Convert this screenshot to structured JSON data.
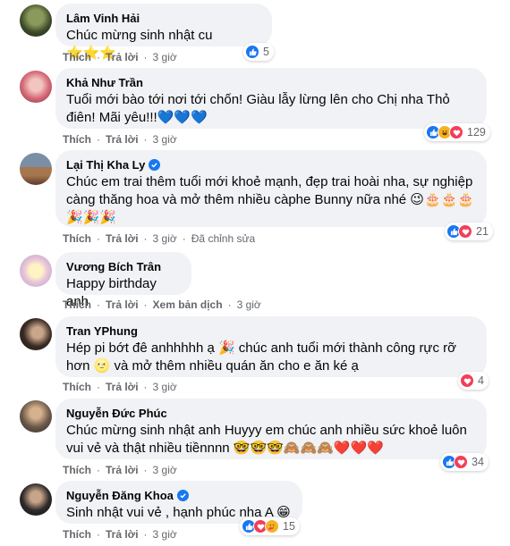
{
  "colors": {
    "like": "#1877f2",
    "love": "#f33e58",
    "haha": "#f7b125",
    "bubble": "#f0f2f5",
    "meta": "#65676b"
  },
  "actions": {
    "like": "Thích",
    "reply": "Trả lời",
    "translate": "Xem bản dịch",
    "edited": "Đã chỉnh sửa",
    "sep": "·"
  },
  "comments": [
    {
      "name": "Lâm Vinh Hải",
      "text": "Chúc mừng sinh nhật cu ⭐⭐⭐",
      "time": "3 giờ",
      "reactions": "5"
    },
    {
      "name": "Khả Như Trần",
      "text": "Tuổi mới bào tới nơi tới chốn! Giàu lẫy lừng lên cho Chị nha Thỏ điên! Mãi yêu!!!💙💙💙",
      "time": "3 giờ",
      "reactions": "129"
    },
    {
      "name": "Lại Thị Kha Ly",
      "text": "Chúc em trai thêm tuổi mới khoẻ mạnh, đẹp trai hoài nha, sự nghiệp càng thăng hoa và mở thêm nhiều càphe Bunny nữa nhé 😉🎂🎂🎂🎉🎉🎉",
      "time": "3 giờ",
      "reactions": "21"
    },
    {
      "name": "Vương Bích Trân",
      "text": "Happy birthday anh",
      "time": "3 giờ"
    },
    {
      "name": "Tran YPhung",
      "text": "Hép pi bớt đê anhhhhh ạ 🎉 chúc anh tuổi mới thành công rực rỡ hơn 🌝 và mở thêm nhiều quán ăn cho e ăn ké ạ",
      "time": "3 giờ",
      "reactions": "4"
    },
    {
      "name": "Nguyễn Đức Phúc",
      "text": "Chúc mừng sinh nhật anh Huyyy em chúc anh nhiều sức khoẻ luôn vui vẻ và thật nhiều tiềnnnn 🤓🤓🤓🙈🙈🙈❤️❤️❤️",
      "time": "3 giờ",
      "reactions": "34"
    },
    {
      "name": "Nguyễn Đăng Khoa",
      "text": "Sinh nhật vui vẻ , hạnh phúc nha A 😁",
      "time": "3 giờ",
      "reactions": "15"
    }
  ]
}
